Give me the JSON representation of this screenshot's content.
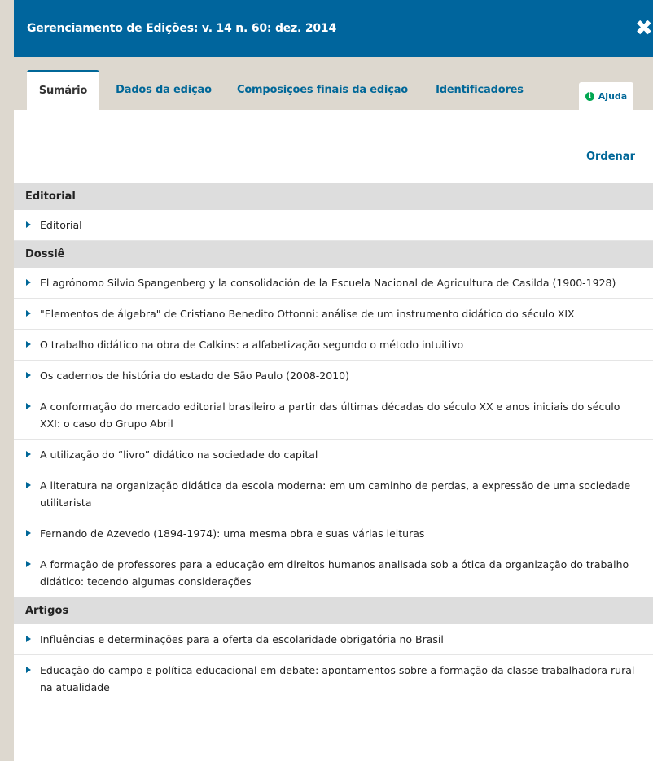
{
  "header": {
    "title": "Gerenciamento de Edições: v. 14 n. 60: dez. 2014",
    "close_icon": "close-x-icon"
  },
  "tabs": [
    {
      "label": "Sumário",
      "active": true
    },
    {
      "label": "Dados da edição",
      "active": false
    },
    {
      "label": "Composições finais da edição",
      "active": false
    },
    {
      "label": "Identificadores",
      "active": false
    }
  ],
  "help": {
    "label": "Ajuda",
    "icon": "info-icon"
  },
  "toc": {
    "order_label": "Ordenar",
    "sections": [
      {
        "title": "Editorial",
        "items": [
          "Editorial"
        ]
      },
      {
        "title": "Dossiê",
        "items": [
          "El agrónomo Silvio Spangenberg y la consolidación de la Escuela Nacional de Agricultura de Casilda (1900-1928)",
          "\"Elementos de álgebra\" de Cristiano Benedito Ottonni: análise de um instrumento didático do século XIX",
          "O trabalho didático na obra de Calkins: a alfabetização segundo o método intuitivo",
          "Os cadernos de história do estado de São Paulo (2008-2010)",
          "A conformação do mercado editorial brasileiro a partir das últimas décadas do século XX e anos iniciais do século XXI: o caso do Grupo Abril",
          "A utilização do “livro” didático na sociedade do capital",
          "A literatura na organização didática da escola moderna: em um caminho de perdas, a expressão de uma sociedade utilitarista",
          "Fernando de Azevedo (1894-1974): uma mesma obra e suas várias leituras",
          "A formação de professores para a educação em direitos humanos analisada sob a ótica da organização do trabalho didático: tecendo algumas considerações"
        ]
      },
      {
        "title": "Artigos",
        "items": [
          "Influências e determinações para a oferta da escolaridade obrigatória no Brasil",
          "Educação do campo e política educacional em debate: apontamentos sobre a formação da classe trabalhadora rural na atualidade"
        ]
      }
    ]
  },
  "colors": {
    "header_bg": "#00659d",
    "link": "#006798",
    "tabbar_bg": "#ddd8cf",
    "section_bg": "#dddddd"
  }
}
